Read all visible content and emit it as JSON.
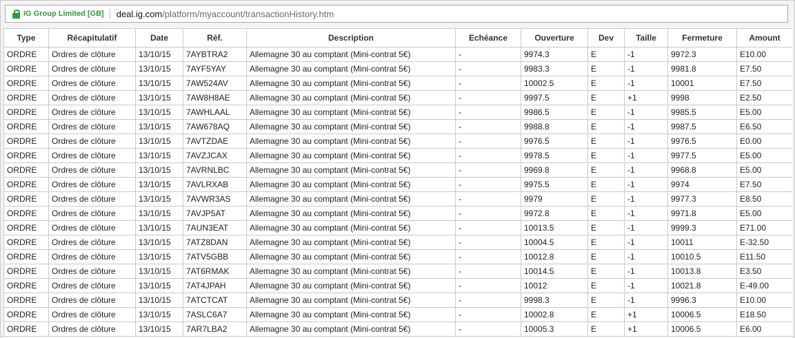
{
  "addressbar": {
    "secure_label": "IG Group Limited [GB]",
    "url_domain": "deal.ig.com",
    "url_path": "/platform/myaccount/transactionHistory.htm"
  },
  "table": {
    "columns": [
      "Type",
      "Récapitulatif",
      "Date",
      "Réf.",
      "Description",
      "Echéance",
      "Ouverture",
      "Dev",
      "Taille",
      "Fermeture",
      "Amount"
    ],
    "rows": [
      [
        "ORDRE",
        "Ordres de clôture",
        "13/10/15",
        "7AYBTRA2",
        "Allemagne 30 au comptant (Mini-contrat 5€)",
        "-",
        "9974.3",
        "E",
        "-1",
        "9972.3",
        "E10.00"
      ],
      [
        "ORDRE",
        "Ordres de clôture",
        "13/10/15",
        "7AYF5YAY",
        "Allemagne 30 au comptant (Mini-contrat 5€)",
        "-",
        "9983.3",
        "E",
        "-1",
        "9981.8",
        "E7.50"
      ],
      [
        "ORDRE",
        "Ordres de clôture",
        "13/10/15",
        "7AW524AV",
        "Allemagne 30 au comptant (Mini-contrat 5€)",
        "-",
        "10002.5",
        "E",
        "-1",
        "10001",
        "E7.50"
      ],
      [
        "ORDRE",
        "Ordres de clôture",
        "13/10/15",
        "7AW8H8AE",
        "Allemagne 30 au comptant (Mini-contrat 5€)",
        "-",
        "9997.5",
        "E",
        "+1",
        "9998",
        "E2.50"
      ],
      [
        "ORDRE",
        "Ordres de clôture",
        "13/10/15",
        "7AWHLAAL",
        "Allemagne 30 au comptant (Mini-contrat 5€)",
        "-",
        "9986.5",
        "E",
        "-1",
        "9985.5",
        "E5.00"
      ],
      [
        "ORDRE",
        "Ordres de clôture",
        "13/10/15",
        "7AW678AQ",
        "Allemagne 30 au comptant (Mini-contrat 5€)",
        "-",
        "9988.8",
        "E",
        "-1",
        "9987.5",
        "E6.50"
      ],
      [
        "ORDRE",
        "Ordres de clôture",
        "13/10/15",
        "7AVTZDAE",
        "Allemagne 30 au comptant (Mini-contrat 5€)",
        "-",
        "9976.5",
        "E",
        "-1",
        "9976.5",
        "E0.00"
      ],
      [
        "ORDRE",
        "Ordres de clôture",
        "13/10/15",
        "7AVZJCAX",
        "Allemagne 30 au comptant (Mini-contrat 5€)",
        "-",
        "9978.5",
        "E",
        "-1",
        "9977.5",
        "E5.00"
      ],
      [
        "ORDRE",
        "Ordres de clôture",
        "13/10/15",
        "7AVRNLBC",
        "Allemagne 30 au comptant (Mini-contrat 5€)",
        "-",
        "9969.8",
        "E",
        "-1",
        "9968.8",
        "E5.00"
      ],
      [
        "ORDRE",
        "Ordres de clôture",
        "13/10/15",
        "7AVLRXAB",
        "Allemagne 30 au comptant (Mini-contrat 5€)",
        "-",
        "9975.5",
        "E",
        "-1",
        "9974",
        "E7.50"
      ],
      [
        "ORDRE",
        "Ordres de clôture",
        "13/10/15",
        "7AVWR3AS",
        "Allemagne 30 au comptant (Mini-contrat 5€)",
        "-",
        "9979",
        "E",
        "-1",
        "9977.3",
        "E8.50"
      ],
      [
        "ORDRE",
        "Ordres de clôture",
        "13/10/15",
        "7AVJP5AT",
        "Allemagne 30 au comptant (Mini-contrat 5€)",
        "-",
        "9972.8",
        "E",
        "-1",
        "9971.8",
        "E5.00"
      ],
      [
        "ORDRE",
        "Ordres de clôture",
        "13/10/15",
        "7AUN3EAT",
        "Allemagne 30 au comptant (Mini-contrat 5€)",
        "-",
        "10013.5",
        "E",
        "-1",
        "9999.3",
        "E71.00"
      ],
      [
        "ORDRE",
        "Ordres de clôture",
        "13/10/15",
        "7ATZ8DAN",
        "Allemagne 30 au comptant (Mini-contrat 5€)",
        "-",
        "10004.5",
        "E",
        "-1",
        "10011",
        "E-32.50"
      ],
      [
        "ORDRE",
        "Ordres de clôture",
        "13/10/15",
        "7ATV5GBB",
        "Allemagne 30 au comptant (Mini-contrat 5€)",
        "-",
        "10012.8",
        "E",
        "-1",
        "10010.5",
        "E11.50"
      ],
      [
        "ORDRE",
        "Ordres de clôture",
        "13/10/15",
        "7AT6RMAK",
        "Allemagne 30 au comptant (Mini-contrat 5€)",
        "-",
        "10014.5",
        "E",
        "-1",
        "10013.8",
        "E3.50"
      ],
      [
        "ORDRE",
        "Ordres de clôture",
        "13/10/15",
        "7AT4JPAH",
        "Allemagne 30 au comptant (Mini-contrat 5€)",
        "-",
        "10012",
        "E",
        "-1",
        "10021.8",
        "E-49.00"
      ],
      [
        "ORDRE",
        "Ordres de clôture",
        "13/10/15",
        "7ATCTCAT",
        "Allemagne 30 au comptant (Mini-contrat 5€)",
        "-",
        "9998.3",
        "E",
        "-1",
        "9996.3",
        "E10.00"
      ],
      [
        "ORDRE",
        "Ordres de clôture",
        "13/10/15",
        "7ASLC6A7",
        "Allemagne 30 au comptant (Mini-contrat 5€)",
        "-",
        "10002.8",
        "E",
        "+1",
        "10006.5",
        "E18.50"
      ],
      [
        "ORDRE",
        "Ordres de clôture",
        "13/10/15",
        "7AR7LBA2",
        "Allemagne 30 au comptant (Mini-contrat 5€)",
        "-",
        "10005.3",
        "E",
        "+1",
        "10006.5",
        "E6.00"
      ]
    ]
  }
}
